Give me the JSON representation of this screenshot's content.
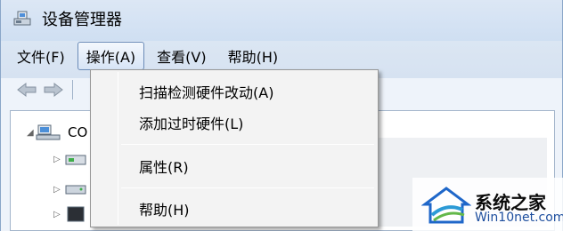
{
  "window": {
    "title": "设备管理器"
  },
  "menubar": {
    "items": [
      {
        "label": "文件(F)"
      },
      {
        "label": "操作(A)"
      },
      {
        "label": "查看(V)"
      },
      {
        "label": "帮助(H)"
      }
    ],
    "active_index": 1
  },
  "toolbar": {
    "icons": [
      "back-arrow-icon",
      "forward-arrow-icon"
    ]
  },
  "tree": {
    "root_label": "CO",
    "root_icon": "computer-icon",
    "children_icons": [
      "network-adapter-icon",
      "disk-drive-icon",
      "display-adapter-icon"
    ]
  },
  "action_menu": {
    "items": [
      {
        "label": "扫描检测硬件改动(A)"
      },
      {
        "label": "添加过时硬件(L)"
      },
      {
        "label": "属性(R)"
      },
      {
        "label": "帮助(H)"
      }
    ]
  },
  "watermark": {
    "title": "系统之家",
    "url": "Win10net.com"
  },
  "colors": {
    "menu_highlight_border": "#6c8cb8",
    "watermark_url": "#1d4e9e"
  }
}
